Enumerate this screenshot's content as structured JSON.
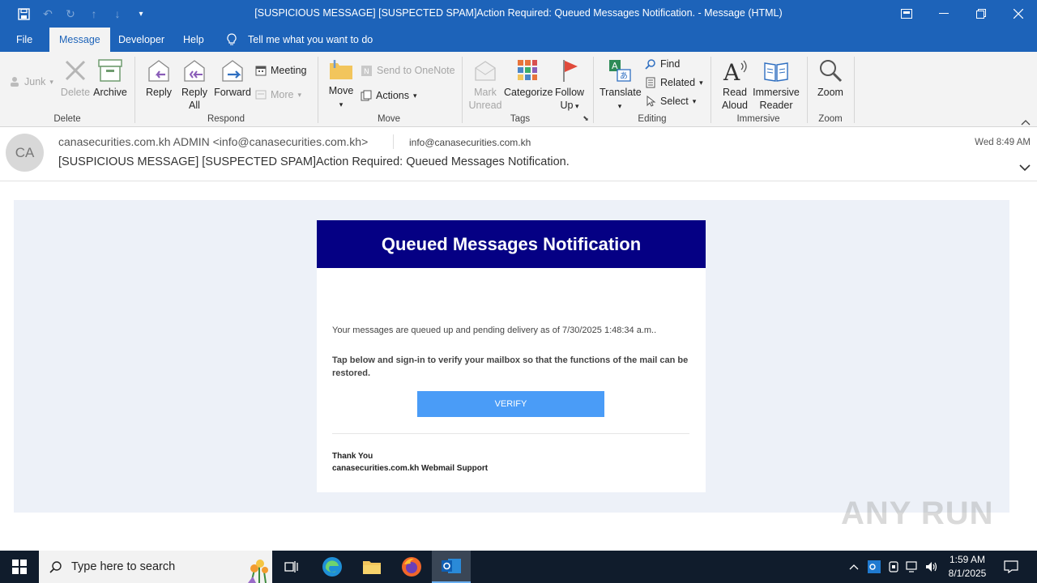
{
  "window": {
    "title": "[SUSPICIOUS MESSAGE] [SUSPECTED SPAM]Action Required: Queued Messages Notification.  -  Message (HTML)"
  },
  "menu": {
    "tabs": [
      "File",
      "Message",
      "Developer",
      "Help"
    ],
    "active_tab": "Message",
    "tell_me": "Tell me what you want to do"
  },
  "ribbon": {
    "delete_group": {
      "label": "Delete",
      "junk": "Junk",
      "delete": "Delete",
      "archive": "Archive"
    },
    "respond_group": {
      "label": "Respond",
      "reply": "Reply",
      "reply_all_1": "Reply",
      "reply_all_2": "All",
      "forward": "Forward",
      "meeting": "Meeting",
      "more": "More"
    },
    "move_group": {
      "label": "Move",
      "move": "Move",
      "send_onenote": "Send to OneNote",
      "actions": "Actions"
    },
    "tags_group": {
      "label": "Tags",
      "mark_unread_1": "Mark",
      "mark_unread_2": "Unread",
      "categorize": "Categorize",
      "follow_up_1": "Follow",
      "follow_up_2": "Up"
    },
    "editing_group": {
      "label": "Editing",
      "translate": "Translate",
      "find": "Find",
      "related": "Related",
      "select": "Select"
    },
    "immersive_group": {
      "label": "Immersive",
      "read_aloud_1": "Read",
      "read_aloud_2": "Aloud",
      "immersive_reader_1": "Immersive",
      "immersive_reader_2": "Reader"
    },
    "zoom_group": {
      "label": "Zoom",
      "zoom": "Zoom"
    }
  },
  "message": {
    "avatar_initials": "CA",
    "sender": "canasecurities.com.kh ADMIN <info@canasecurities.com.kh>",
    "to": "info@canasecurities.com.kh",
    "time": "Wed 8:49 AM",
    "subject": "[SUSPICIOUS MESSAGE] [SUSPECTED SPAM]Action Required: Queued Messages Notification."
  },
  "email": {
    "banner_title": "Queued Messages Notification",
    "paragraph1": "Your messages are queued up and pending delivery as of 7/30/2025 1:48:34 a.m..",
    "paragraph2": "Tap below and sign-in to verify your mailbox so that the functions of the mail can be restored.",
    "button": "VERIFY",
    "thanks": "Thank You",
    "signature": "canasecurities.com.kh Webmail Support"
  },
  "watermark": "ANY RUN",
  "taskbar": {
    "search_placeholder": "Type here to search",
    "time": "1:59 AM",
    "date": "8/1/2025"
  },
  "colors": {
    "title_bar": "#1d63b9",
    "banner": "#050084",
    "verify_button": "#4a9cf7",
    "body_background": "#edf1f8"
  }
}
